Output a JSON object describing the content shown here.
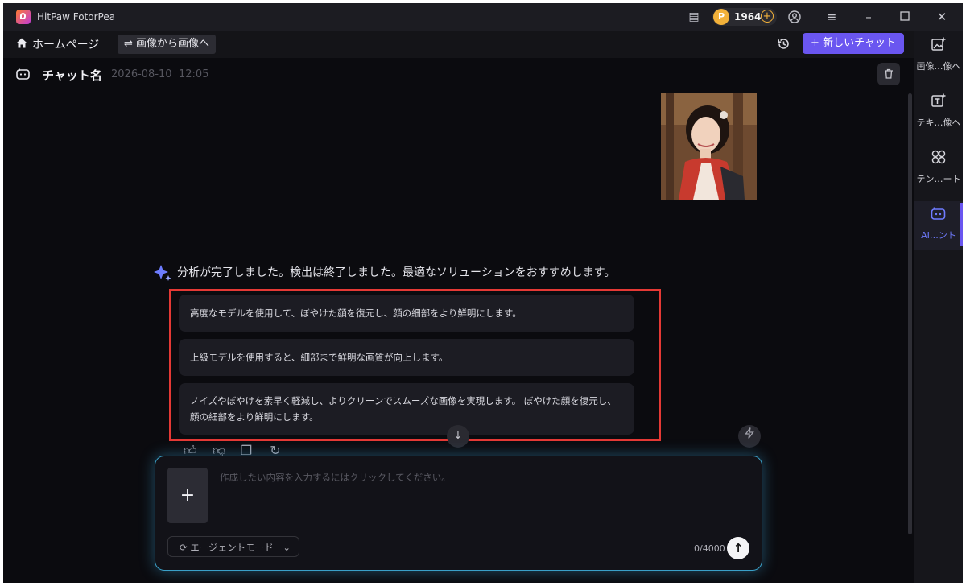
{
  "app": {
    "title": "HitPaw FotorPea"
  },
  "titlebar": {
    "coins": "1964"
  },
  "toolbar": {
    "home_label": "ホームページ",
    "i2i_label": "⇌ 画像から画像へ",
    "new_chat_label": "+ 新しいチャット"
  },
  "chat": {
    "name": "チャット名",
    "date": "2026-08-10",
    "time": "12:05",
    "analysis_text": "分析が完了しました。検出は終了しました。最適なソリューションをおすすめします。",
    "suggestions": [
      "高度なモデルを使用して、ぼやけた顔を復元し、顔の細部をより鮮明にします。",
      "上級モデルを使用すると、細部まで鮮明な画質が向上します。",
      "ノイズやぼやけを素早く軽減し、よりクリーンでスムーズな画像を実現します。 ぼやけた顔を復元し、顔の細部をより鮮明にします。"
    ]
  },
  "input": {
    "placeholder": "作成したい内容を入力するにはクリックしてください。",
    "agent_mode_label": "エージェントモード",
    "counter": "0/4000"
  },
  "rail": {
    "items": [
      {
        "label": "画像…像へ",
        "icon": "image-add-icon"
      },
      {
        "label": "テキ…像へ",
        "icon": "text-image-icon"
      },
      {
        "label": "テン…ート",
        "icon": "template-icon"
      },
      {
        "label": "AI…ント",
        "icon": "ai-agent-icon"
      }
    ]
  },
  "colors": {
    "accent": "#6a56f0",
    "highlight_border": "#e53935",
    "input_glow": "#3aa0c8"
  }
}
